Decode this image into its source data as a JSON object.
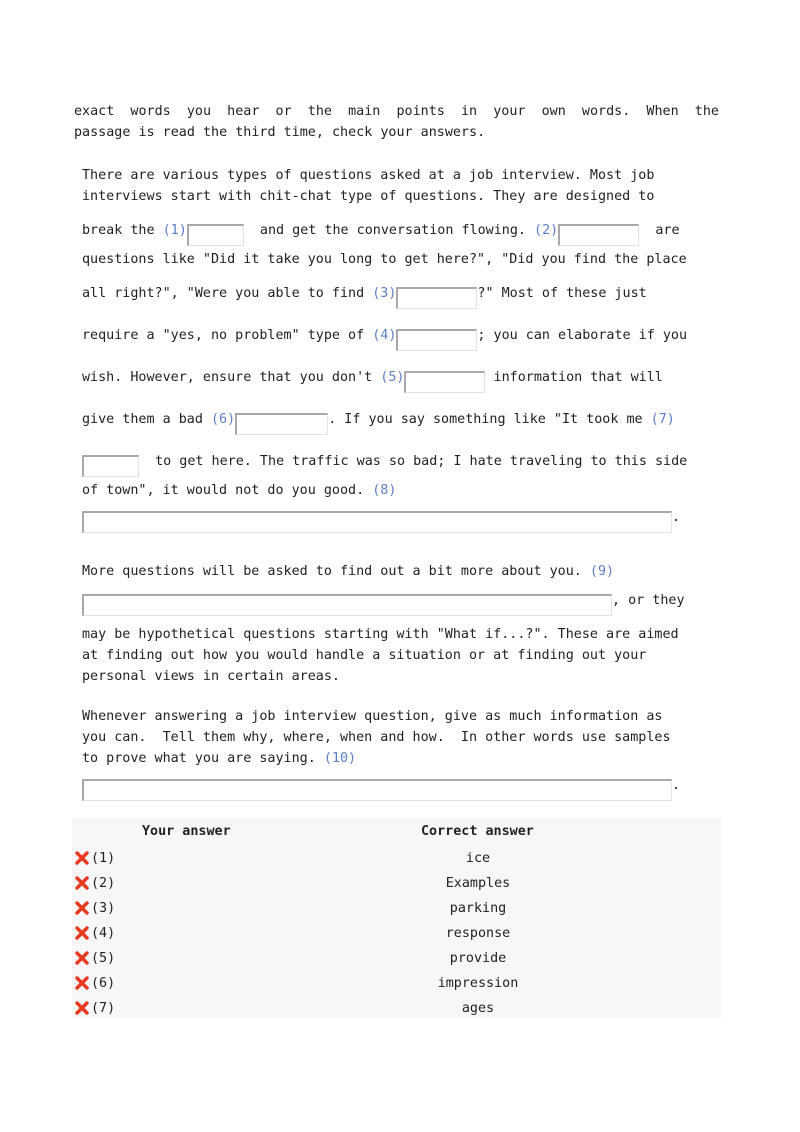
{
  "intro": [
    "exact  words  you  hear  or  the  main  points  in  your  own  words.  When  the",
    "passage is read the third time, check your answers."
  ],
  "passage": [
    [
      {
        "t": "There are various types of questions asked at a job interview. Most job"
      }
    ],
    [
      {
        "t": "interviews start with chit-chat type of questions. They are designed to"
      }
    ],
    [
      {
        "t": "break the "
      },
      {
        "n": "(1)"
      },
      {
        "b": 1
      },
      {
        "t": "  and get the conversation flowing. "
      },
      {
        "n": "(2)"
      },
      {
        "b": 2
      },
      {
        "t": "  are"
      }
    ],
    [
      {
        "t": "questions like \"Did it take you long to get here?\", \"Did you find the place"
      }
    ],
    [
      {
        "t": "all right?\", \"Were you able to find "
      },
      {
        "n": "(3)"
      },
      {
        "b": 3
      },
      {
        "t": "?\" Most of these just"
      }
    ],
    [
      {
        "t": "require a \"yes, no problem\" type of "
      },
      {
        "n": "(4)"
      },
      {
        "b": 4
      },
      {
        "t": "; you can elaborate if you"
      }
    ],
    [
      {
        "t": "wish. However, ensure that you don't "
      },
      {
        "n": "(5)"
      },
      {
        "b": 5
      },
      {
        "t": " information that will"
      }
    ],
    [
      {
        "t": "give them a bad "
      },
      {
        "n": "(6)"
      },
      {
        "b": 6
      },
      {
        "t": ". If you say something like \"It took me "
      },
      {
        "n": "(7)"
      }
    ],
    [
      {
        "b": 7
      },
      {
        "t": "  to get here. The traffic was so bad; I hate traveling to this side"
      }
    ],
    [
      {
        "t": "of town\", it would not do you good. "
      },
      {
        "n": "(8)"
      }
    ],
    [
      {
        "b": 8
      },
      {
        "t": "."
      }
    ],
    [
      {
        "t": "More questions will be asked to find out a bit more about you. "
      },
      {
        "n": "(9)"
      }
    ],
    [
      {
        "b": 9
      },
      {
        "t": ", or they"
      }
    ],
    [
      {
        "t": "may be hypothetical questions starting with \"What if...?\". These are aimed"
      }
    ],
    [
      {
        "t": "at finding out how you would handle a situation or at finding out your"
      }
    ],
    [
      {
        "t": "personal views in certain areas."
      }
    ],
    [
      {
        "t": "Whenever answering a job interview question, give as much information as"
      }
    ],
    [
      {
        "t": "you can.  Tell them why, where, when and how.  In other words use samples"
      }
    ],
    [
      {
        "t": "to prove what you are saying. "
      },
      {
        "n": "(10)"
      }
    ],
    [
      {
        "b": 10
      },
      {
        "t": "."
      }
    ]
  ],
  "results": {
    "your_answer_header": "Your answer",
    "correct_answer_header": "Correct answer",
    "status_icon": "red-x-icon",
    "rows": [
      {
        "num": "(1)",
        "your": "",
        "correct": "ice"
      },
      {
        "num": "(2)",
        "your": "",
        "correct": "Examples"
      },
      {
        "num": "(3)",
        "your": "",
        "correct": "parking"
      },
      {
        "num": "(4)",
        "your": "",
        "correct": "response"
      },
      {
        "num": "(5)",
        "your": "",
        "correct": "provide"
      },
      {
        "num": "(6)",
        "your": "",
        "correct": "impression"
      },
      {
        "num": "(7)",
        "your": "",
        "correct": "ages"
      }
    ]
  },
  "colors": {
    "blank_number": "#5b7fc7",
    "wrong_icon": "#e8391f",
    "table_bg": "#f7f7f7"
  }
}
